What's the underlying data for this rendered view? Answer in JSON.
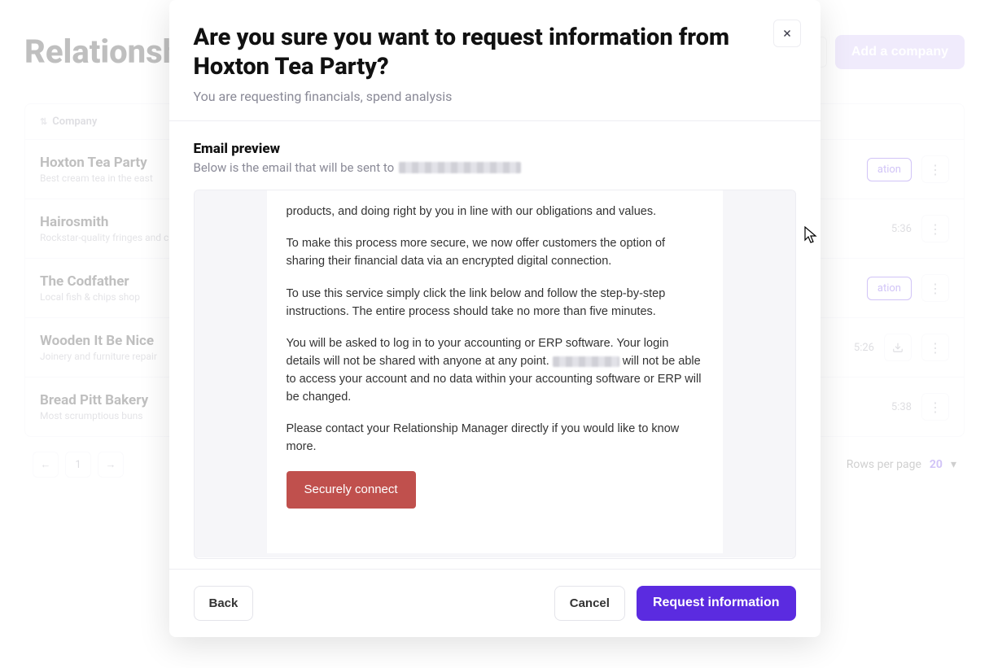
{
  "page": {
    "title": "Relationships",
    "add_button": "Add a company"
  },
  "table": {
    "col_company": "Company",
    "rows": [
      {
        "name": "Hoxton Tea Party",
        "desc": "Best cream tea in the east",
        "badge": "ation"
      },
      {
        "name": "Hairosmith",
        "desc": "Rockstar-quality fringes and cuts",
        "time": "5:36"
      },
      {
        "name": "The Codfather",
        "desc": "Local fish & chips shop",
        "badge": "ation"
      },
      {
        "name": "Wooden It Be Nice",
        "desc": "Joinery and furniture repair",
        "time": "5:26"
      },
      {
        "name": "Bread Pitt Bakery",
        "desc": "Most scrumptious buns",
        "time": "5:38"
      }
    ]
  },
  "pagination": {
    "page": "1",
    "rows_label": "Rows per page",
    "rows_value": "20"
  },
  "modal": {
    "title": "Are you sure you want to request information from Hoxton Tea Party?",
    "subtitle": "You are requesting financials, spend analysis",
    "preview_title": "Email preview",
    "preview_sub": "Below is the email that will be sent to",
    "back": "Back",
    "cancel": "Cancel",
    "confirm": "Request information"
  },
  "email": {
    "p1": "products, and doing right by you in line with our obligations and values.",
    "p2": "To make this process more secure, we now offer customers the option of sharing their financial data via an encrypted digital connection.",
    "p3": "To use this service simply click the link below and follow the step-by-step instructions. The entire process should take no more than five minutes.",
    "p4a": "You will be asked to log in to your accounting or ERP software. Your login details will not be shared with anyone at any point. ",
    "p4b": " will not be able to access your account and no data within your accounting software or ERP will be changed.",
    "p5": "Please contact your Relationship Manager directly if you would like to know more.",
    "cta": "Securely connect"
  }
}
